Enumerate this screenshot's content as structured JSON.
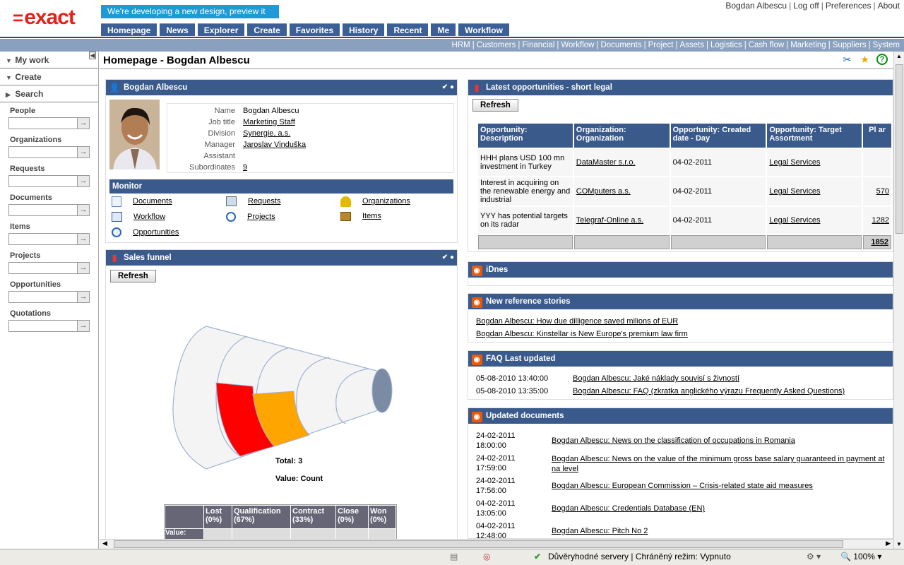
{
  "brand": {
    "logo": "exact",
    "logo_mark": "="
  },
  "preview_banner": "We're developing a new design, preview it here!",
  "user_nav": [
    "Bogdan Albescu",
    "Log off",
    "Preferences",
    "About"
  ],
  "main_nav": [
    "Homepage",
    "News",
    "Explorer",
    "Create",
    "Favorites",
    "History",
    "Recent",
    "Me",
    "Workflow"
  ],
  "sub_nav": [
    "HRM",
    "Customers",
    "Financial",
    "Workflow",
    "Documents",
    "Project",
    "Assets",
    "Logistics",
    "Cash flow",
    "Marketing",
    "Suppliers",
    "System"
  ],
  "left": {
    "heads": [
      "My work",
      "Create",
      "Search"
    ],
    "sections": [
      "People",
      "Organizations",
      "Requests",
      "Documents",
      "Items",
      "Projects",
      "Opportunities",
      "Quotations"
    ],
    "go": "→"
  },
  "page_title": "Homepage - Bogdan Albescu",
  "profile": {
    "title": "Bogdan Albescu",
    "fields": [
      {
        "label": "Name",
        "value": "Bogdan Albescu",
        "link": false
      },
      {
        "label": "Job title",
        "value": "Marketing Staff",
        "link": true
      },
      {
        "label": "Division",
        "value": "Synergie, a.s.",
        "link": true
      },
      {
        "label": "Manager",
        "value": "Jaroslav Vinduška",
        "link": true
      },
      {
        "label": "Assistant",
        "value": "",
        "link": false
      },
      {
        "label": "Subordinates",
        "value": "9",
        "link": true
      }
    ],
    "monitor_title": "Monitor",
    "monitor": [
      "Documents",
      "Requests",
      "Organizations",
      "Workflow",
      "Projects",
      "Items",
      "Opportunities"
    ]
  },
  "sales_funnel": {
    "title": "Sales funnel",
    "refresh": "Refresh",
    "total": "Total: 3",
    "value_label": "Value: Count",
    "headers": [
      "Lost (0%)",
      "Qualification (67%)",
      "Contract (33%)",
      "Close (0%)",
      "Won (0%)"
    ],
    "row_label": "Value:"
  },
  "chart_data": {
    "type": "funnel",
    "title": "Sales funnel",
    "categories": [
      "Lost",
      "Qualification",
      "Contract",
      "Close",
      "Won"
    ],
    "values": [
      0,
      67,
      33,
      0,
      0
    ],
    "colors": [
      "#ff0000",
      "#ffa500"
    ]
  },
  "opportunities": {
    "title": "Latest opportunities - short legal",
    "refresh": "Refresh",
    "headers": [
      "Opportunity: Description",
      "Organization: Organization",
      "Opportunity: Created date - Day",
      "Opportunity: Target Assortment",
      "Pl ar"
    ],
    "rows": [
      [
        "HHH plans USD 100 mn investment in Turkey",
        "DataMaster s.r.o.",
        "04-02-2011",
        "Legal Services",
        ""
      ],
      [
        "Interest in acquiring on the renewable energy and industrial",
        "COMputers a.s.",
        "04-02-2011",
        "Legal Services",
        "570"
      ],
      [
        "YYY has potential targets on its radar",
        "Telegraf-Online a.s.",
        "04-02-2011",
        "Legal Services",
        "1282"
      ]
    ],
    "total": "1852"
  },
  "idnes": {
    "title": "iDnes"
  },
  "reference": {
    "title": "New reference stories",
    "items": [
      "Bogdan Albescu: How due dilligence saved milions of EUR",
      "Bogdan Albescu: Kinstellar is New Europe's premium law firm"
    ]
  },
  "faq": {
    "title": "FAQ Last updated",
    "items": [
      {
        "date": "05-08-2010 13:40:00",
        "text": "Bogdan Albescu: Jaké náklady souvisí s živností"
      },
      {
        "date": "05-08-2010 13:35:00",
        "text": "Bogdan Albescu: FAQ (zkratka anglického výrazu Frequently Asked Questions)"
      }
    ]
  },
  "updated_docs": {
    "title": "Updated documents",
    "items": [
      {
        "date": "24-02-2011",
        "time": "18:00:00",
        "text": "Bogdan Albescu: News on the classification of occupations in Romania"
      },
      {
        "date": "24-02-2011",
        "time": "17:59:00",
        "text": "Bogdan Albescu: News on the value of the minimum gross base salary guaranteed in payment at na level"
      },
      {
        "date": "24-02-2011",
        "time": "17:56:00",
        "text": "Bogdan Albescu: European Commission – Crisis-related state aid measures"
      },
      {
        "date": "04-02-2011",
        "time": "13:05:00",
        "text": "Bogdan Albescu: Credentials Database (EN)"
      },
      {
        "date": "04-02-2011",
        "time": "12:48:00",
        "text": "Bogdan Albescu: Pitch No 2"
      }
    ]
  },
  "status": {
    "zone": "Důvěryhodné servery | Chráněný režim: Vypnuto",
    "zoom": "100%"
  }
}
